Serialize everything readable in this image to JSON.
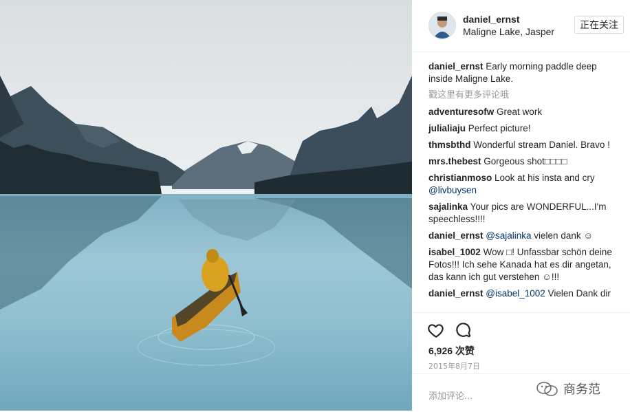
{
  "post": {
    "photo_icon": "photo-canoe-lake",
    "username": "daniel_ernst",
    "location": "Maligne Lake, Jasper",
    "follow_label": "正在关注"
  },
  "comments": [
    {
      "user": "daniel_ernst",
      "mention": "",
      "text": "Early morning paddle deep inside Maligne Lake."
    },
    {
      "user": "adventuresofw",
      "mention": "",
      "text": "Great work"
    },
    {
      "user": "julialiaju",
      "mention": "",
      "text": "Perfect picture!"
    },
    {
      "user": "thmsbthd",
      "mention": "",
      "text": "Wonderful stream Daniel. Bravo !"
    },
    {
      "user": "mrs.thebest",
      "mention": "",
      "text": "Gorgeous shot□□□□"
    },
    {
      "user": "christianmoso",
      "mention": "@livbuysen",
      "text": "Look at his insta and cry",
      "mention_after": true
    },
    {
      "user": "sajalinka",
      "mention": "",
      "text": "Your pics are WONDERFUL...I'm speechless!!!!"
    },
    {
      "user": "daniel_ernst",
      "mention": "@sajalinka",
      "text": "vielen dank ☺"
    },
    {
      "user": "isabel_1002",
      "mention": "",
      "text": "Wow □! Unfassbar schön deine Fotos!!! Ich sehe Kanada hat es dir angetan, das kann ich gut verstehen ☺!!!"
    },
    {
      "user": "daniel_ernst",
      "mention": "@isabel_1002",
      "text": "Vielen Dank dir"
    }
  ],
  "more_comments": "戳这里有更多评论哦",
  "actions": {
    "like_icon": "heart-icon",
    "comment_icon": "comment-icon",
    "likes": "6,926 次赞",
    "date": "2015年8月7日",
    "add_comment_placeholder": "添加评论...",
    "watermark": "商务范"
  }
}
